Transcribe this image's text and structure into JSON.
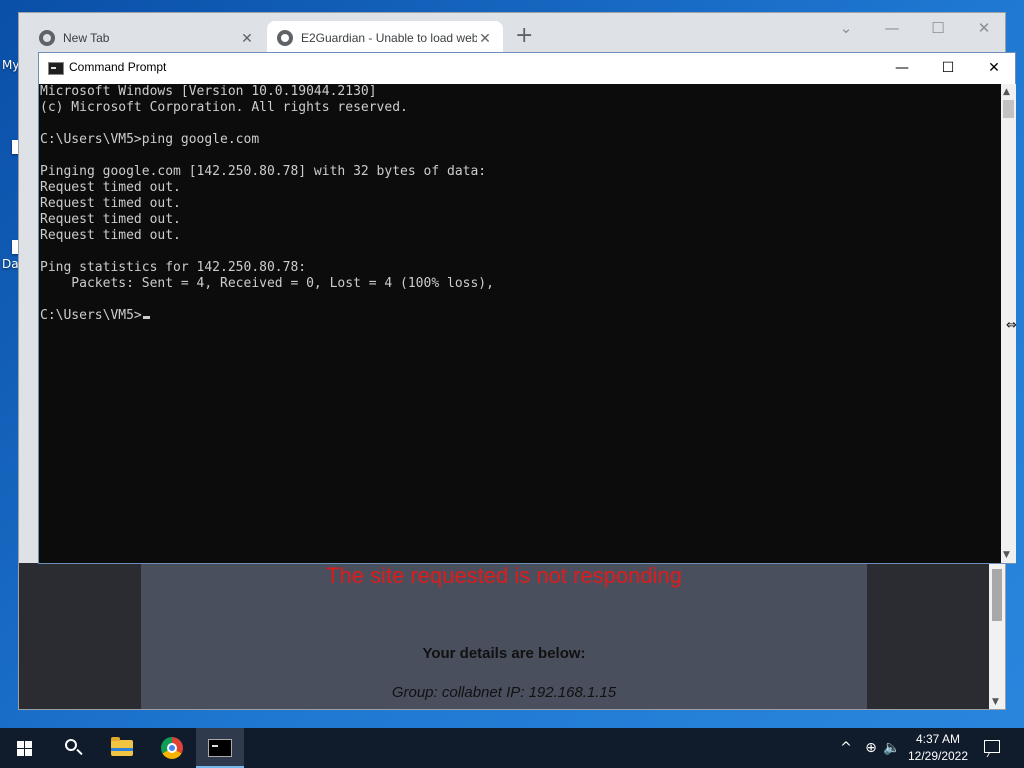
{
  "desktop": {
    "icon_label_1": "My",
    "icon_label_2": "Da"
  },
  "browser": {
    "tabs": [
      {
        "label": "New Tab",
        "active": false
      },
      {
        "label": "E2Guardian - Unable to load web",
        "active": true
      }
    ],
    "new_tab_glyph": "+",
    "controls": {
      "chevron": "⌄",
      "minimize": "—",
      "maximize": "☐",
      "close": "✕"
    }
  },
  "page": {
    "error_title": "The site requested is not responding",
    "details_title": "Your details are below:",
    "details_line": "Group: collabnet   IP: 192.168.1.15"
  },
  "cmd": {
    "title": "Command Prompt",
    "controls": {
      "minimize": "—",
      "maximize": "☐",
      "close": "✕"
    },
    "lines": [
      "Microsoft Windows [Version 10.0.19044.2130]",
      "(c) Microsoft Corporation. All rights reserved.",
      "",
      "C:\\Users\\VM5>ping google.com",
      "",
      "Pinging google.com [142.250.80.78] with 32 bytes of data:",
      "Request timed out.",
      "Request timed out.",
      "Request timed out.",
      "Request timed out.",
      "",
      "Ping statistics for 142.250.80.78:",
      "    Packets: Sent = 4, Received = 0, Lost = 4 (100% loss),",
      ""
    ],
    "prompt": "C:\\Users\\VM5>"
  },
  "taskbar": {
    "tray": {
      "chevron": "^",
      "network": "⊕",
      "volume": "🔈"
    },
    "clock": {
      "time": "4:37 AM",
      "date": "12/29/2022"
    }
  },
  "colors": {
    "cmd_background": "#0c0c0c",
    "cmd_text": "#cccccc",
    "error_red": "#e01b1b",
    "taskbar": "#101c2b"
  }
}
